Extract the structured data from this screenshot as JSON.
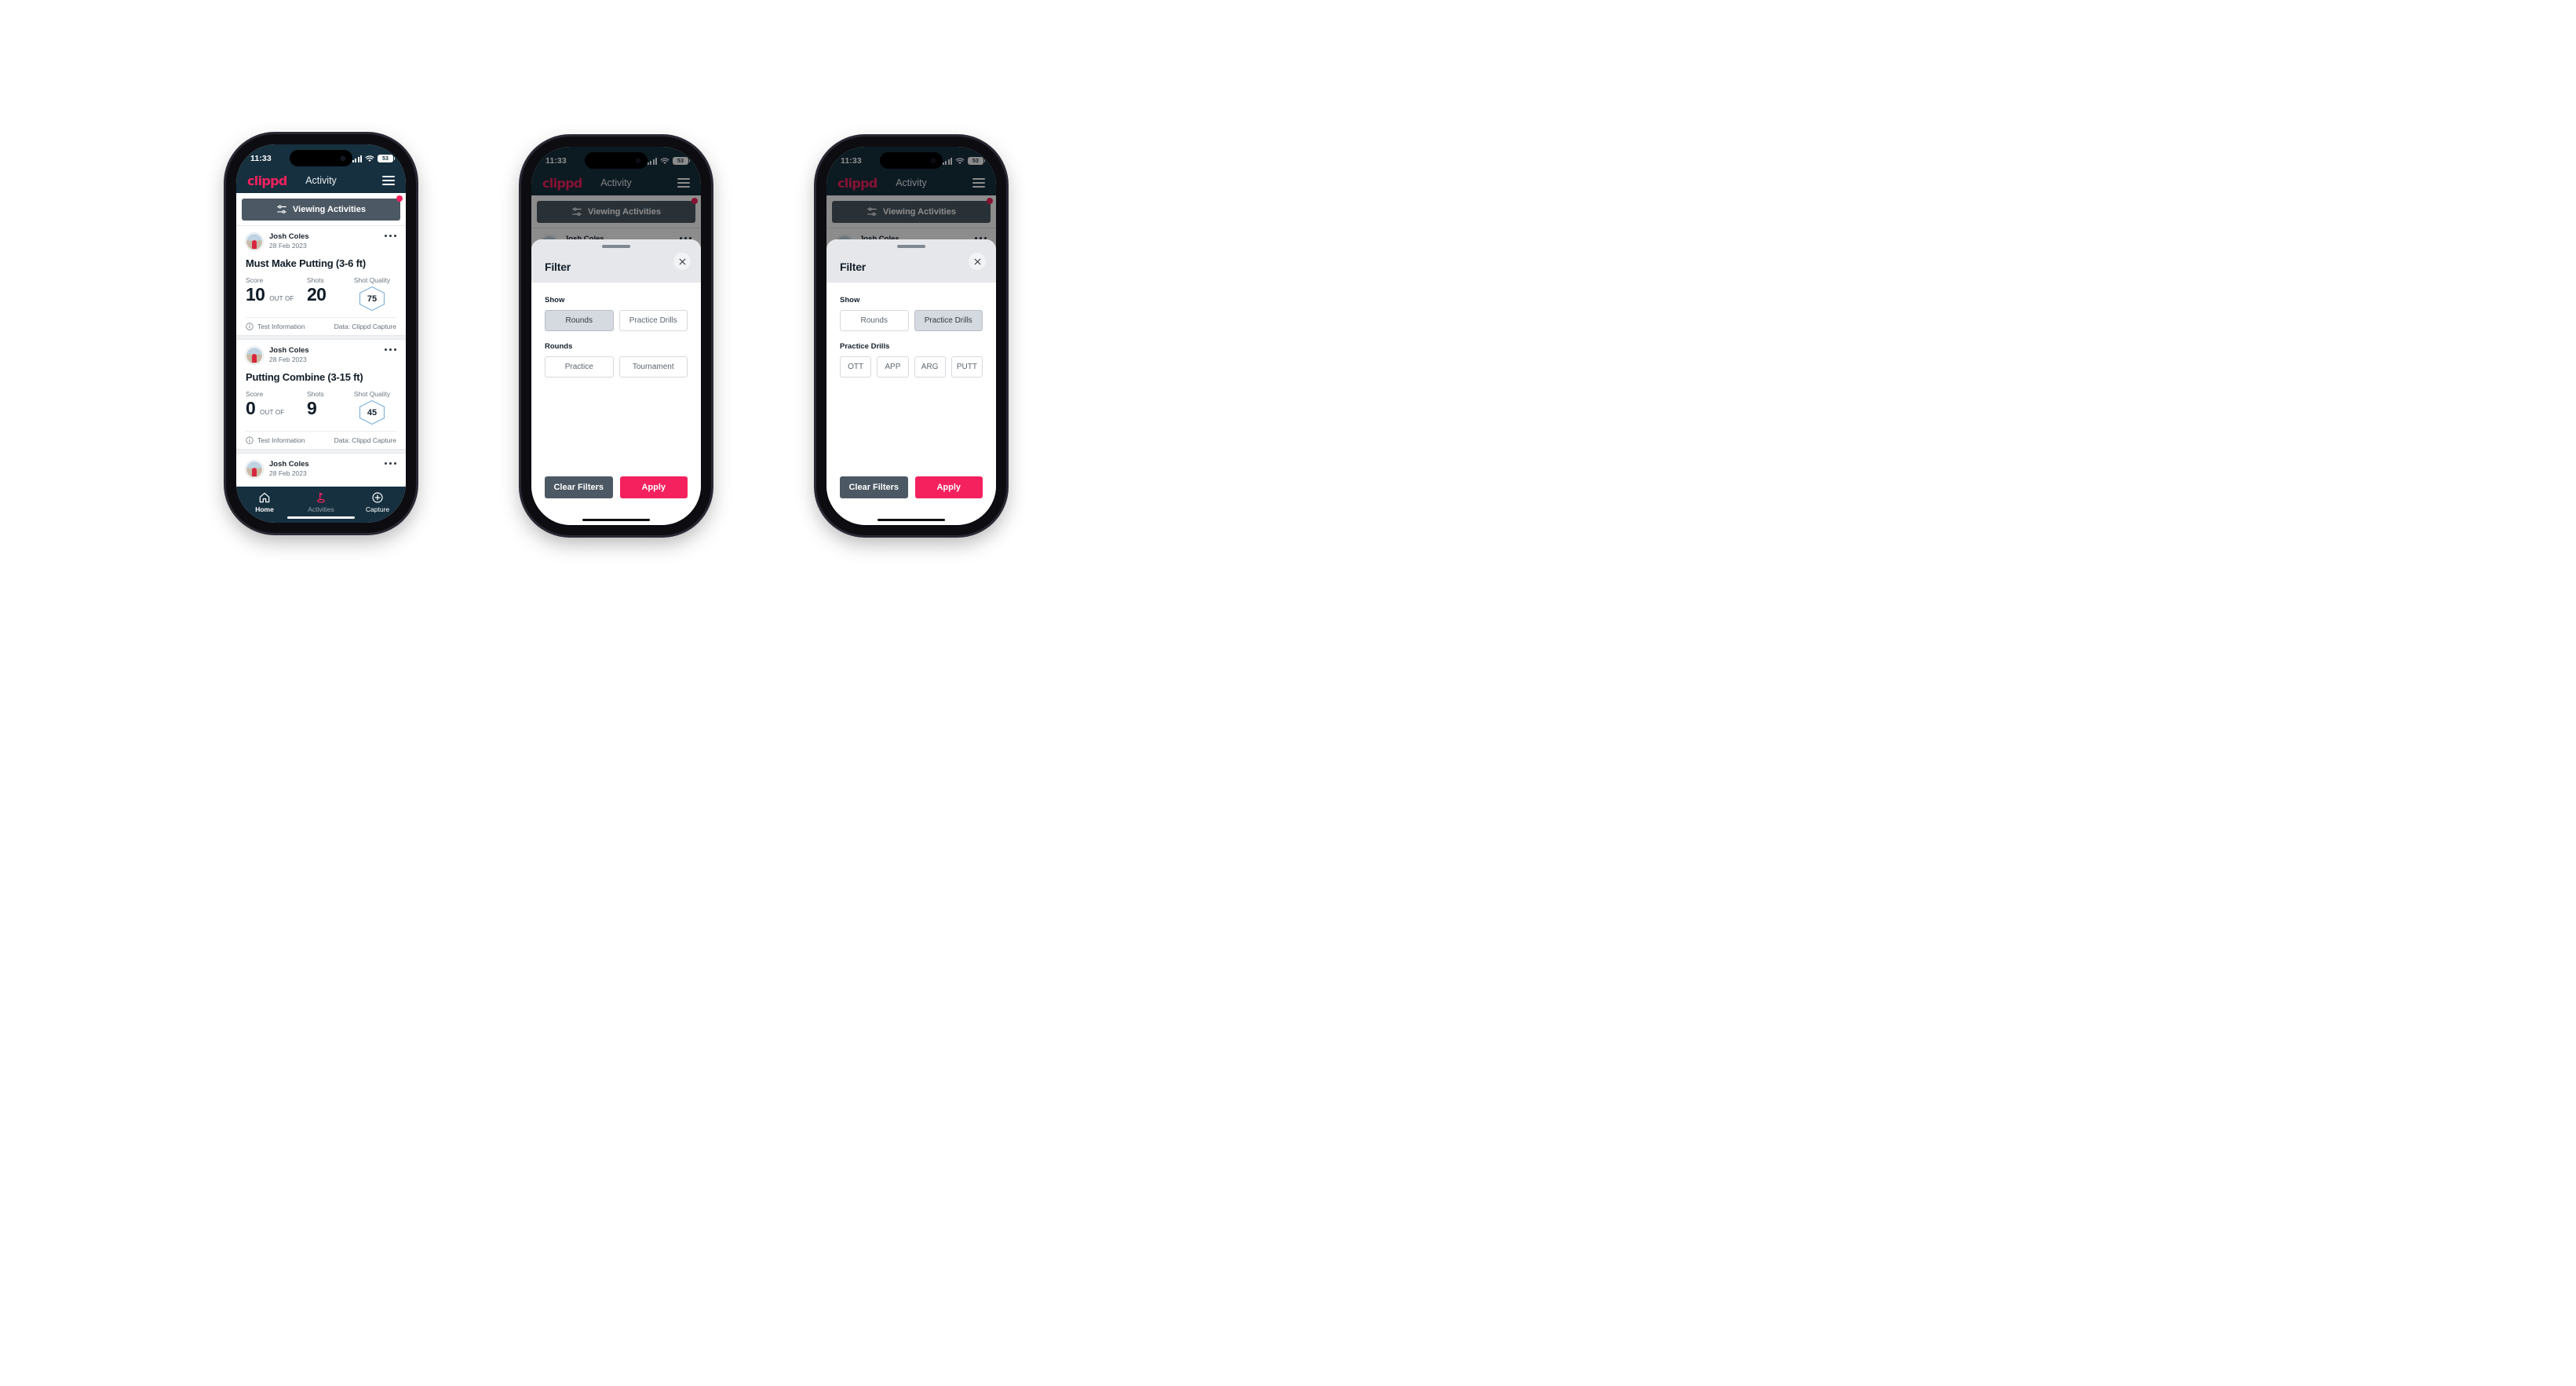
{
  "theme": {
    "brand_pink": "#f4215e",
    "header_navy": "#16303f",
    "slate": "#4c5964",
    "chip_active_bg": "#d5d9e0"
  },
  "status_bar": {
    "time": "11:33",
    "battery": "53",
    "signal_icon": "cellular-signal-icon",
    "wifi_icon": "wifi-icon",
    "battery_icon": "battery-icon"
  },
  "header": {
    "logo": "clippd",
    "title": "Activity",
    "menu_icon": "hamburger-menu-icon"
  },
  "filter_bar": {
    "label": "Viewing Activities",
    "icon": "sliders-filter-icon",
    "badge_icon": "notification-dot-icon"
  },
  "activities": [
    {
      "user": "Josh Coles",
      "date": "28 Feb 2023",
      "title": "Must Make Putting (3-6 ft)",
      "score_label": "Score",
      "score_value": "10",
      "out_of_label": "OUT OF",
      "shots_label": "Shots",
      "shots_value": "20",
      "quality_label": "Shot Quality",
      "quality_value": "75",
      "footer_left": "Test Information",
      "footer_right": "Data: Clippd Capture",
      "menu_icon": "more-options-icon",
      "info_icon": "info-circle-icon",
      "avatar_icon": "user-avatar"
    },
    {
      "user": "Josh Coles",
      "date": "28 Feb 2023",
      "title": "Putting Combine (3-15 ft)",
      "score_label": "Score",
      "score_value": "0",
      "out_of_label": "OUT OF",
      "shots_label": "Shots",
      "shots_value": "9",
      "quality_label": "Shot Quality",
      "quality_value": "45",
      "footer_left": "Test Information",
      "footer_right": "Data: Clippd Capture",
      "menu_icon": "more-options-icon",
      "info_icon": "info-circle-icon",
      "avatar_icon": "user-avatar"
    },
    {
      "user": "Josh Coles",
      "date": "28 Feb 2023",
      "menu_icon": "more-options-icon",
      "avatar_icon": "user-avatar"
    }
  ],
  "bottom_nav": {
    "items": [
      {
        "label": "Home",
        "icon": "home-icon",
        "active": false
      },
      {
        "label": "Activities",
        "icon": "golf-flag-icon",
        "active": true
      },
      {
        "label": "Capture",
        "icon": "plus-circle-icon",
        "active": false
      }
    ]
  },
  "filter_sheet": {
    "title": "Filter",
    "close_icon": "close-x-icon",
    "grabber_icon": "drag-handle-icon",
    "show_label": "Show",
    "show_options": [
      "Rounds",
      "Practice Drills"
    ],
    "rounds_label": "Rounds",
    "rounds_options": [
      "Practice",
      "Tournament"
    ],
    "practice_drills_label": "Practice Drills",
    "practice_drills_options": [
      "OTT",
      "APP",
      "ARG",
      "PUTT"
    ],
    "clear_label": "Clear Filters",
    "apply_label": "Apply",
    "phone2_selected_show": "Rounds",
    "phone3_selected_show": "Practice Drills"
  }
}
